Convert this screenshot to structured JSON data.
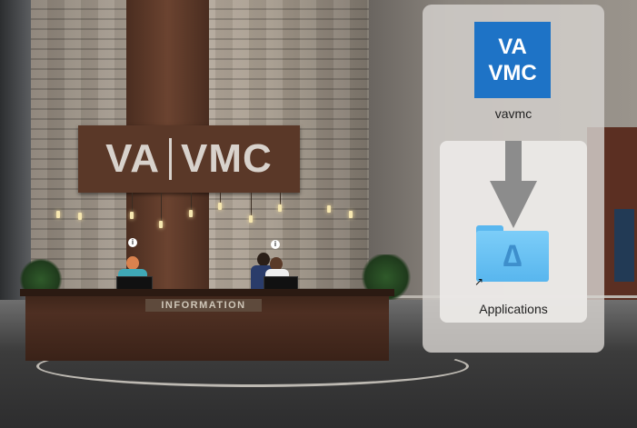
{
  "scene": {
    "wall_sign": {
      "left": "VA",
      "right": "VMC"
    },
    "desk_sign": "INFORMATION"
  },
  "installer": {
    "app_icon": {
      "line1": "VA",
      "line2": "VMC",
      "color": "#1e73c6"
    },
    "app_name": "vavmc",
    "arrow_icon": "down-arrow-icon",
    "target_folder": {
      "name": "Applications",
      "icon": "applications-folder-icon",
      "color": "#6fc4f5"
    },
    "alias_icon": "alias-arrow-icon"
  }
}
